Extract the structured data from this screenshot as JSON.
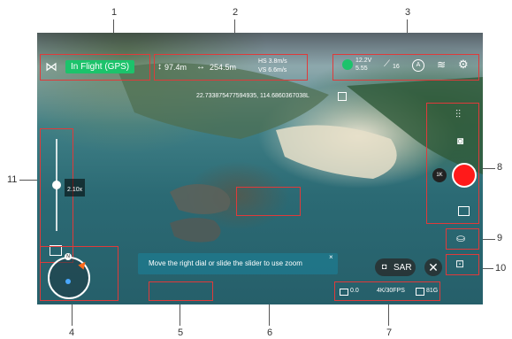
{
  "callouts": [
    "1",
    "2",
    "3",
    "4",
    "5",
    "6",
    "7",
    "8",
    "9",
    "10",
    "11"
  ],
  "status": {
    "flight_state": "In Flight (GPS)"
  },
  "telemetry": {
    "height": "97.4m",
    "distance": "254.5m",
    "hs": "HS  3.8m/s",
    "vs": "VS  6.6m/s"
  },
  "top_right": {
    "battery_voltage": "12.2V",
    "battery_level": "5.55",
    "signal": "16",
    "mode_letter": "A"
  },
  "coordinates": "22.733875477594935, 114.6860367038L",
  "zoom": {
    "value": "2.10x",
    "level_fraction": 0.5
  },
  "tooltip": {
    "text": "Move the right dial or slide the slider to use zoom"
  },
  "camera": {
    "iso_label": "1K",
    "sar_label": "SAR"
  },
  "bottom_bar": {
    "ev": "0.0",
    "format": "4K/30FPS",
    "storage": "81G"
  },
  "colors": {
    "accent_green": "#1cc36b",
    "record_red": "#ff1a1a",
    "callout_red": "#e03a3a"
  }
}
